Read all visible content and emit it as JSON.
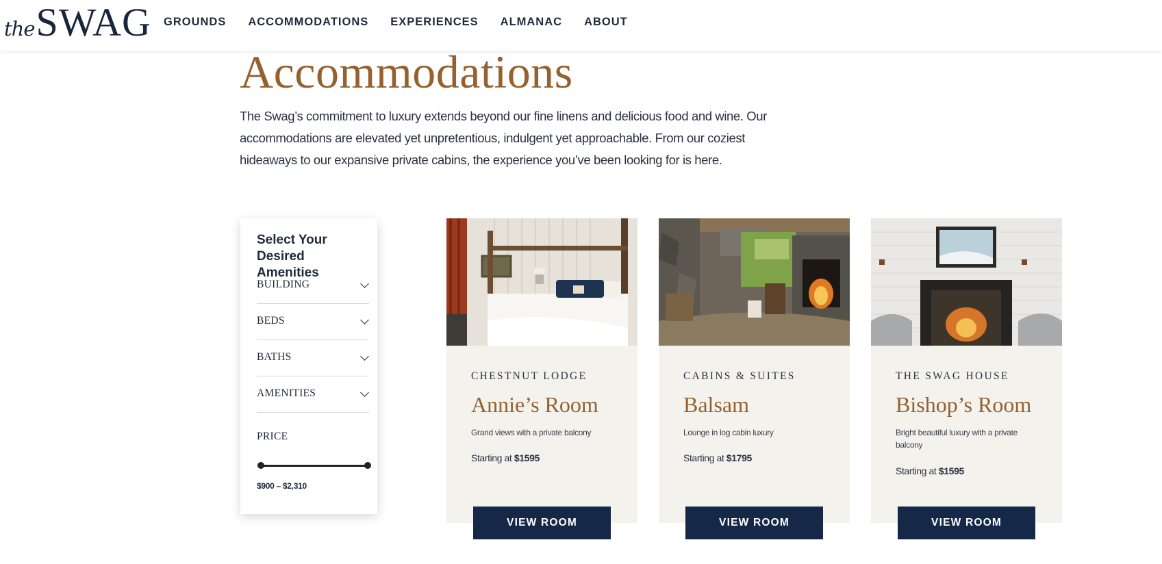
{
  "header": {
    "logo_the": "the",
    "logo_swag": "SWAG",
    "nav": [
      "GROUNDS",
      "ACCOMMODATIONS",
      "EXPERIENCES",
      "ALMANAC",
      "ABOUT"
    ]
  },
  "intro": {
    "title": "Accommodations",
    "text": "The Swag’s commitment to luxury extends beyond our fine linens and delicious food and wine. Our accommodations are elevated yet unpretentious, indulgent yet approachable. From our coziest hideaways to our expansive private cabins, the experience you’ve been looking for is here."
  },
  "filter": {
    "title": "Select Your Desired Amenities",
    "rows": [
      "BUILDING",
      "BEDS",
      "BATHS",
      "AMENITIES"
    ],
    "price_label": "PRICE",
    "price_range": "$900 – $2,310"
  },
  "cards": [
    {
      "category": "CHESTNUT LODGE",
      "name": "Annie’s Room",
      "description": "Grand views with a private balcony",
      "price_prefix": "Starting at ",
      "price": "$1595",
      "button": "VIEW ROOM",
      "image": "bedroom-photo"
    },
    {
      "category": "CABINS & SUITES",
      "name": "Balsam",
      "description": "Lounge in log cabin luxury",
      "price_prefix": "Starting at ",
      "price": "$1795",
      "button": "VIEW ROOM",
      "image": "cabin-fireplace-photo"
    },
    {
      "category": "THE SWAG HOUSE",
      "name": "Bishop’s Room",
      "description": "Bright beautiful luxury with a private balcony",
      "price_prefix": "Starting at ",
      "price": "$1595",
      "button": "VIEW ROOM",
      "image": "brick-fireplace-photo"
    }
  ],
  "colors": {
    "accent": "#94612f",
    "navy": "#152848",
    "card_bg": "#f4f2ec"
  }
}
